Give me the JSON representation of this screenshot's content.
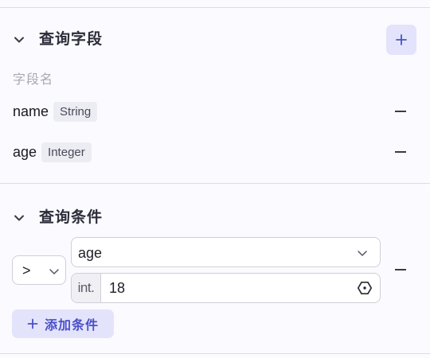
{
  "query_fields": {
    "title": "查询字段",
    "caption": "字段名",
    "fields": [
      {
        "name": "name",
        "type": "String"
      },
      {
        "name": "age",
        "type": "Integer"
      }
    ]
  },
  "query_conditions": {
    "title": "查询条件",
    "condition": {
      "operator": ">",
      "field": "age",
      "value_type": "int.",
      "value": "18"
    },
    "add_label": "添加条件"
  },
  "colors": {
    "accent": "#4b4fc9",
    "accent_bg": "#e3e4fb",
    "tag_bg": "#ecedf2",
    "divider": "#dcdce3"
  },
  "icons": {
    "collapse": "chevron-down-icon",
    "add": "plus-icon",
    "remove": "minus-icon",
    "type_toggle": "hexagon-icon"
  }
}
